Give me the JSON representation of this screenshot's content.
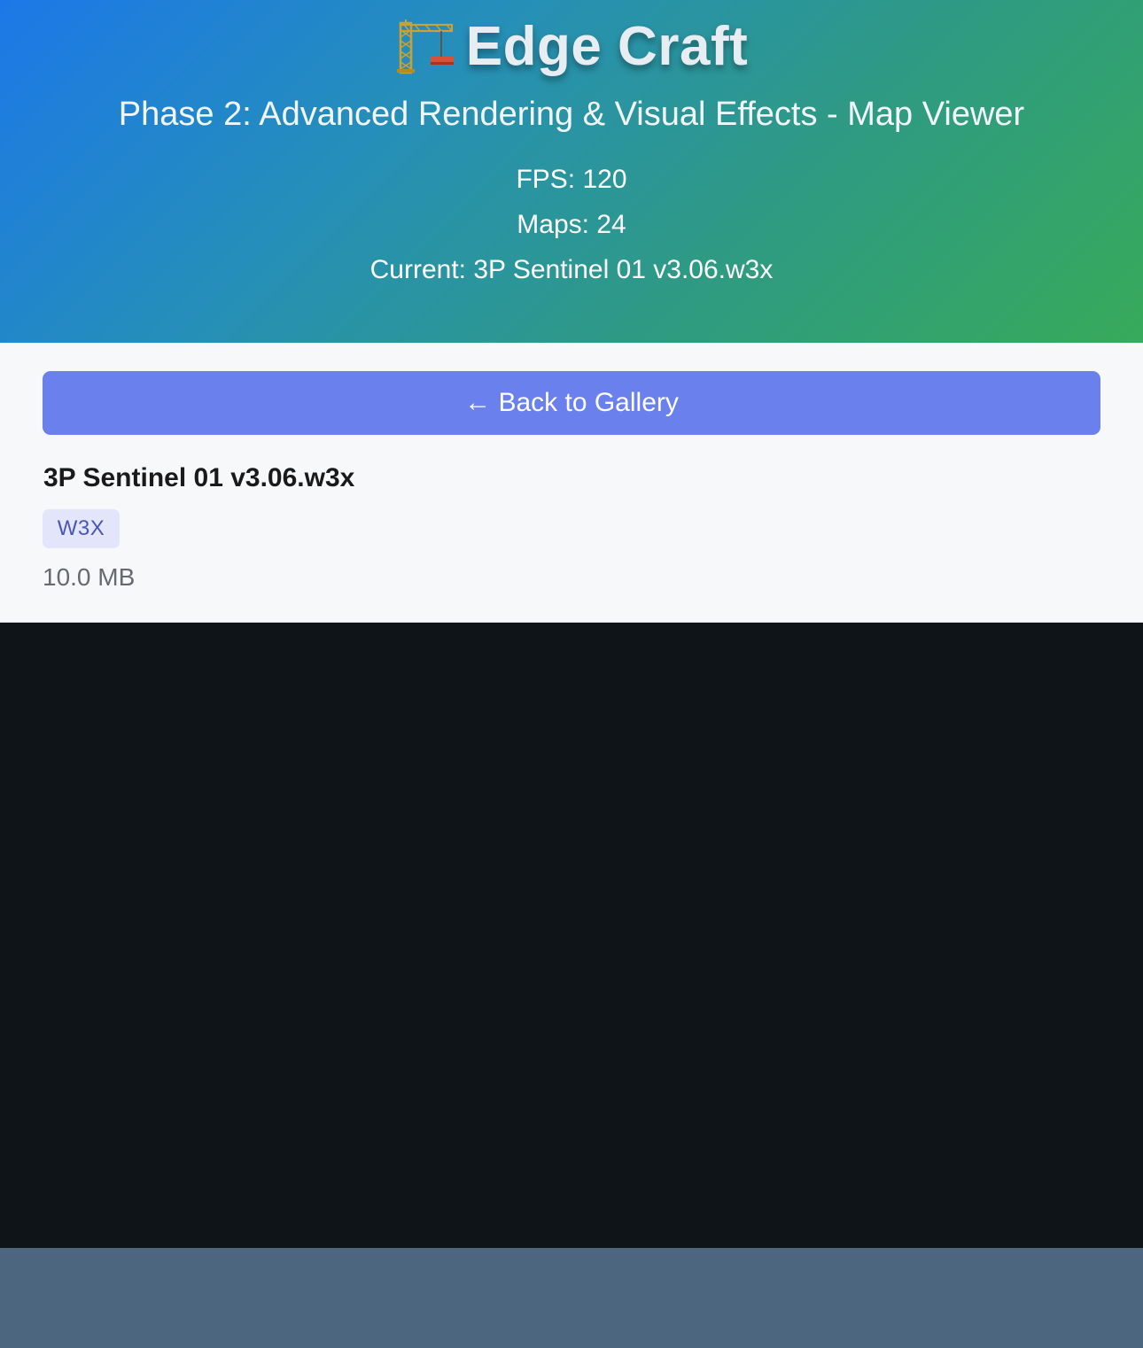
{
  "header": {
    "icon": "construction-crane-icon",
    "title": "Edge Craft",
    "subtitle": "Phase 2: Advanced Rendering & Visual Effects - Map Viewer",
    "fps_text": "FPS: 120",
    "maps_text": "Maps: 24",
    "current_text": "Current: 3P Sentinel 01 v3.06.w3x",
    "gradient_colors": [
      "#1c78e8",
      "#38aa5a"
    ]
  },
  "panel": {
    "back_label": "← Back to Gallery",
    "back_color": "#6a80ec",
    "map_name": "3P Sentinel 01 v3.06.w3x",
    "format_badge": "W3X",
    "file_size": "10.0 MB"
  },
  "viewport": {
    "background": "#0f1418"
  },
  "footer": {
    "background": "#4b667e"
  }
}
